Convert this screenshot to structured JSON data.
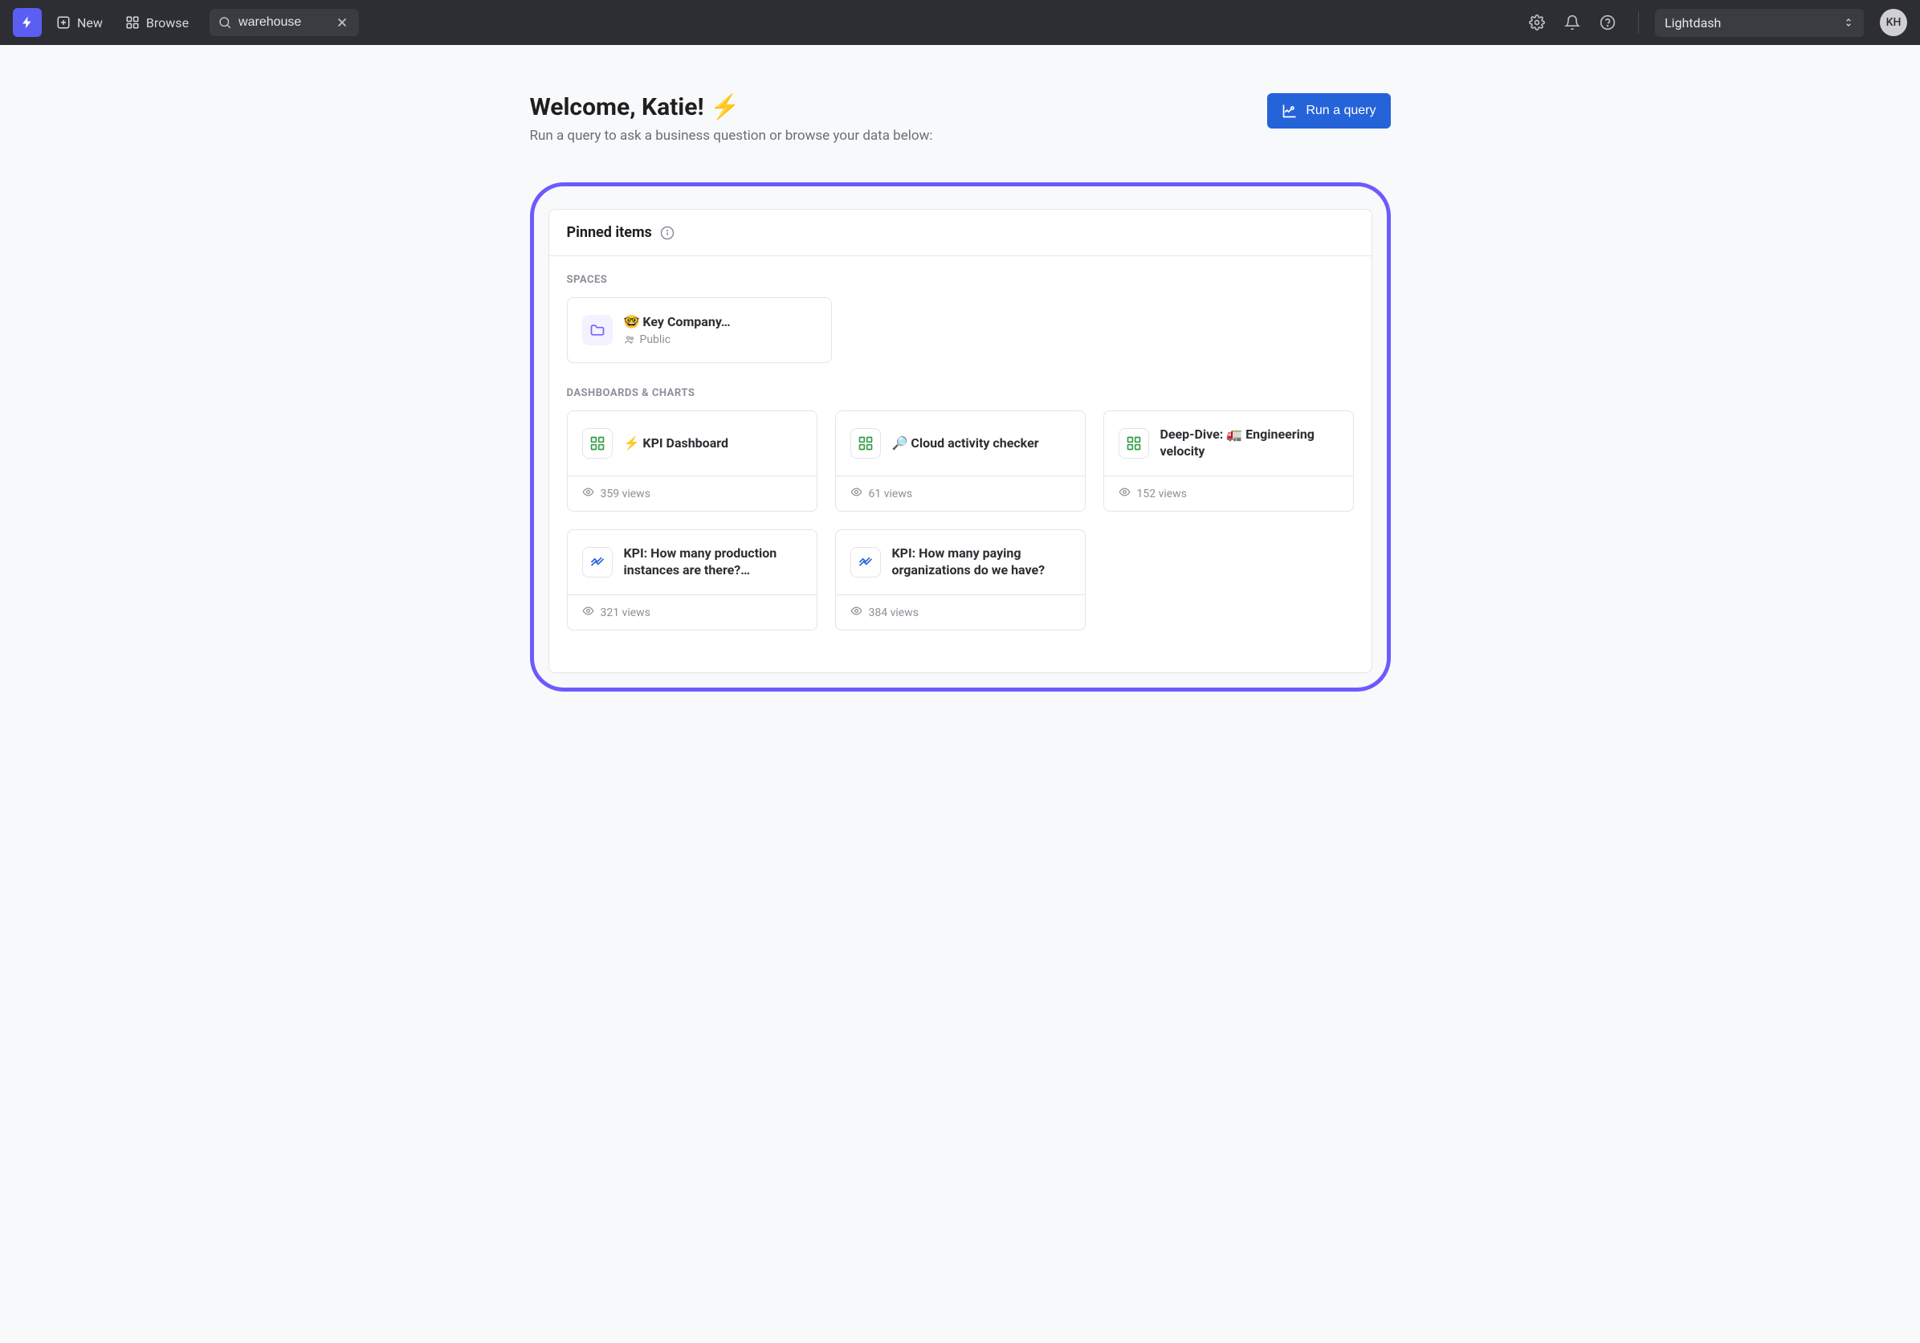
{
  "topbar": {
    "new_label": "New",
    "browse_label": "Browse",
    "search_value": "warehouse",
    "project_name": "Lightdash",
    "avatar_initials": "KH"
  },
  "hero": {
    "title": "Welcome, Katie! ⚡",
    "subtitle": "Run a query to ask a business question or browse your data below:",
    "run_query_label": "Run a query"
  },
  "pinned": {
    "header": "Pinned items",
    "spaces_label": "SPACES",
    "dashboards_label": "DASHBOARDS & CHARTS",
    "spaces": [
      {
        "title": "🤓 Key Company…",
        "visibility": "Public"
      }
    ],
    "items": [
      {
        "type": "dashboard",
        "title": "⚡ KPI Dashboard",
        "views": "359 views"
      },
      {
        "type": "dashboard",
        "title": "🔎 Cloud activity checker",
        "views": "61 views"
      },
      {
        "type": "dashboard",
        "title": "Deep-Dive: 🚛 Engineering velocity",
        "views": "152 views"
      },
      {
        "type": "chart",
        "title": "KPI: How many production instances are there?…",
        "views": "321 views"
      },
      {
        "type": "chart",
        "title": "KPI: How many paying organizations do we have?",
        "views": "384 views"
      }
    ]
  }
}
